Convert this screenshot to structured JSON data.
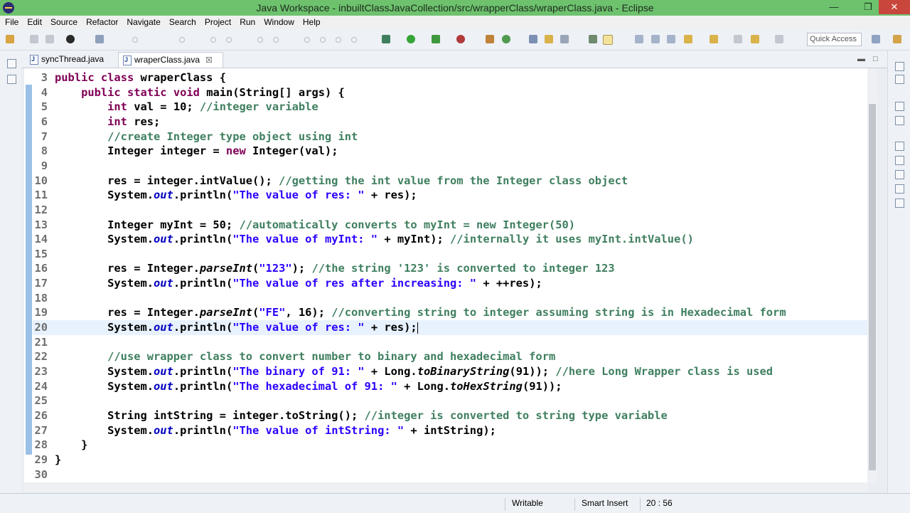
{
  "window": {
    "title": "Java Workspace - inbuiltClassJavaCollection/src/wrapperClass/wraperClass.java - Eclipse"
  },
  "menu": [
    "File",
    "Edit",
    "Source",
    "Refactor",
    "Navigate",
    "Search",
    "Project",
    "Run",
    "Window",
    "Help"
  ],
  "toolbar": {
    "quick_access_placeholder": "Quick Access"
  },
  "tabs": [
    {
      "label": "syncThread.java",
      "active": false
    },
    {
      "label": "wraperClass.java",
      "active": true,
      "close": "☒"
    }
  ],
  "editor": {
    "lines": [
      {
        "n": "3",
        "code": "public class wraperClass {"
      },
      {
        "n": "4",
        "code": "    public static void main(String[] args) {"
      },
      {
        "n": "5",
        "code": "        int val = 10; //integer variable"
      },
      {
        "n": "6",
        "code": "        int res;"
      },
      {
        "n": "7",
        "code": "        //create Integer type object using int"
      },
      {
        "n": "8",
        "code": "        Integer integer = new Integer(val);"
      },
      {
        "n": "9",
        "code": ""
      },
      {
        "n": "10",
        "code": "        res = integer.intValue(); //getting the int value from the Integer class object"
      },
      {
        "n": "11",
        "code": "        System.out.println(\"The value of res: \" + res);"
      },
      {
        "n": "12",
        "code": ""
      },
      {
        "n": "13",
        "code": "        Integer myInt = 50; //automatically converts to myInt = new Integer(50)"
      },
      {
        "n": "14",
        "code": "        System.out.println(\"The value of myInt: \" + myInt); //internally it uses myInt.intValue()"
      },
      {
        "n": "15",
        "code": ""
      },
      {
        "n": "16",
        "code": "        res = Integer.parseInt(\"123\"); //the string '123' is converted to integer 123"
      },
      {
        "n": "17",
        "code": "        System.out.println(\"The value of res after increasing: \" + ++res);"
      },
      {
        "n": "18",
        "code": ""
      },
      {
        "n": "19",
        "code": "        res = Integer.parseInt(\"FE\", 16); //converting string to integer assuming string is in Hexadecimal form"
      },
      {
        "n": "20",
        "code": "        System.out.println(\"The value of res: \" + res);"
      },
      {
        "n": "21",
        "code": ""
      },
      {
        "n": "22",
        "code": "        //use wrapper class to convert number to binary and hexadecimal form"
      },
      {
        "n": "23",
        "code": "        System.out.println(\"The binary of 91: \" + Long.toBinaryString(91)); //here Long Wrapper class is used"
      },
      {
        "n": "24",
        "code": "        System.out.println(\"The hexadecimal of 91: \" + Long.toHexString(91));"
      },
      {
        "n": "25",
        "code": ""
      },
      {
        "n": "26",
        "code": "        String intString = integer.toString(); //integer is converted to string type variable"
      },
      {
        "n": "27",
        "code": "        System.out.println(\"The value of intString: \" + intString);"
      },
      {
        "n": "28",
        "code": "    }"
      },
      {
        "n": "29",
        "code": "}"
      },
      {
        "n": "30",
        "code": ""
      }
    ],
    "current_line": "20"
  },
  "status": {
    "writable": "Writable",
    "insert_mode": "Smart Insert",
    "position": "20 : 56"
  },
  "colors": {
    "keyword": "#7f0055",
    "comment": "#3f7f5f",
    "string": "#2a00ff",
    "field": "#0000c0",
    "titlebar": "#6ec26e"
  }
}
